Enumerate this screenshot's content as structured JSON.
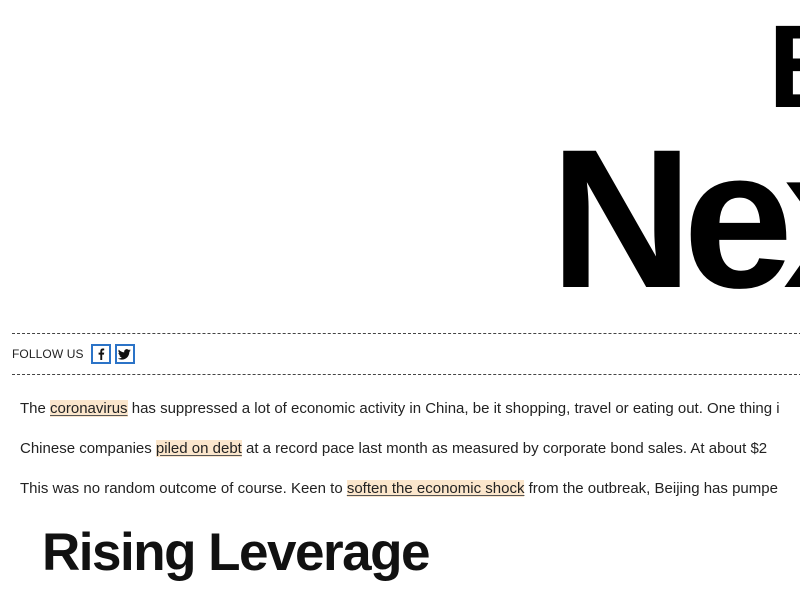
{
  "hero": {
    "line_top": "B",
    "line_main": "Nex"
  },
  "follow": {
    "label": "FOLLOW US",
    "facebook_icon": "facebook-icon",
    "twitter_icon": "twitter-icon",
    "accent_color": "#2b73c7"
  },
  "article": {
    "p1": {
      "before": "The ",
      "link": "coronavirus",
      "after": " has suppressed a lot of economic activity in China, be it shopping, travel or eating out. One thing i"
    },
    "p2": {
      "before": "Chinese companies ",
      "link": "piled on debt",
      "after": " at a record pace last month as measured by corporate bond sales. At about $2"
    },
    "p3": {
      "before": "This was no random outcome of course. Keen to ",
      "link": "soften the economic shock",
      "after": " from the outbreak, Beijing has pumpe"
    },
    "highlight_color": "#fbe6cc"
  },
  "figure": {
    "title": "Rising Leverage"
  }
}
